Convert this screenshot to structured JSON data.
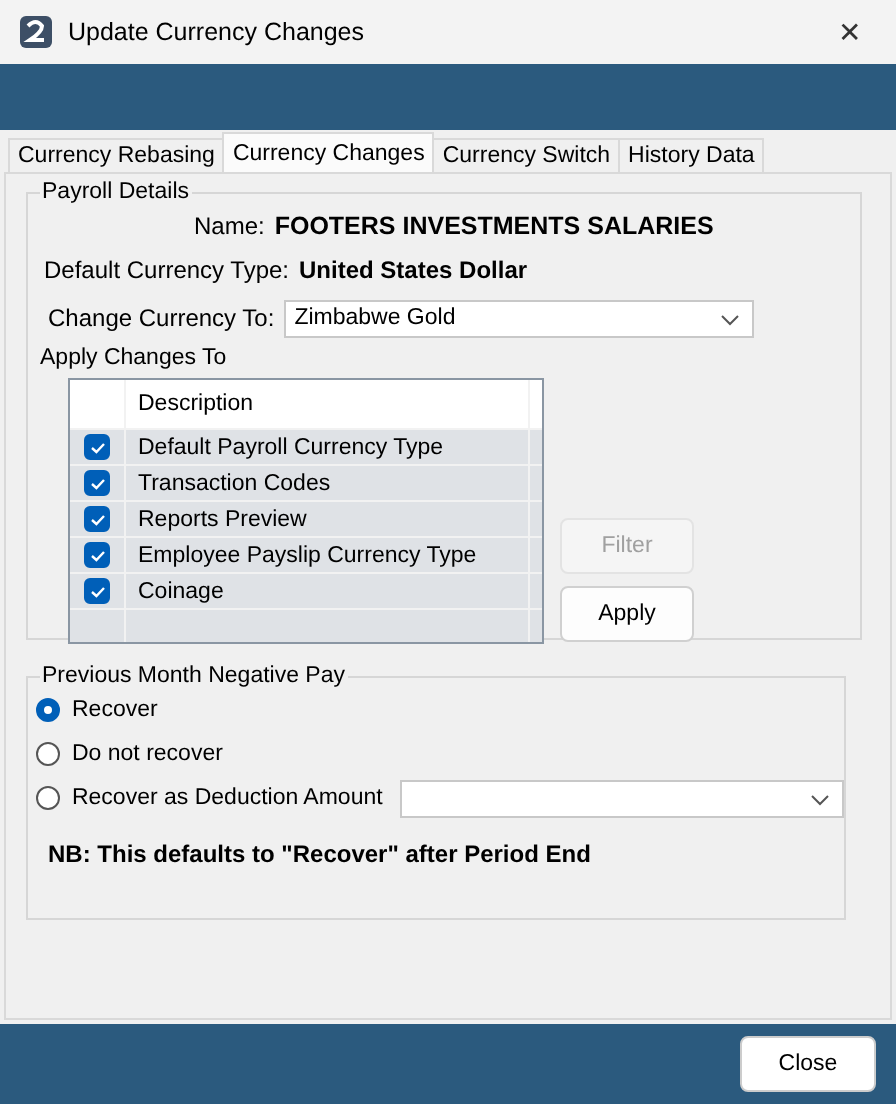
{
  "window": {
    "title": "Update Currency Changes",
    "close": "✕"
  },
  "tabs": [
    {
      "label": "Currency Rebasing",
      "selected": false
    },
    {
      "label": "Currency Changes",
      "selected": true
    },
    {
      "label": "Currency Switch",
      "selected": false
    },
    {
      "label": "History Data",
      "selected": false
    }
  ],
  "payroll_details": {
    "title": "Payroll Details",
    "name_label": "Name:",
    "name_value": "FOOTERS INVESTMENTS SALARIES",
    "default_label": "Default Currency Type:",
    "default_value": "United States Dollar",
    "change_label": "Change Currency To:",
    "change_value": "Zimbabwe Gold",
    "apply_label": "Apply Changes To",
    "grid_header": "Description",
    "rows": [
      {
        "description": "Default Payroll Currency Type",
        "checked": true
      },
      {
        "description": "Transaction Codes",
        "checked": true
      },
      {
        "description": "Reports Preview",
        "checked": true
      },
      {
        "description": "Employee Payslip Currency Type",
        "checked": true
      },
      {
        "description": "Coinage",
        "checked": true
      }
    ],
    "buttons": [
      {
        "label": "Filter",
        "disabled": true
      },
      {
        "label": "Apply",
        "disabled": false
      }
    ]
  },
  "negative_pay": {
    "title": "Previous Month Negative Pay",
    "options": [
      {
        "label": "Recover",
        "selected": true
      },
      {
        "label": "Do not recover",
        "selected": false
      },
      {
        "label": "Recover as Deduction Amount",
        "selected": false,
        "kind": "dropdown"
      }
    ],
    "note": "NB: This defaults to \"Recover\" after Period End"
  },
  "footer": {
    "button": "Close"
  }
}
